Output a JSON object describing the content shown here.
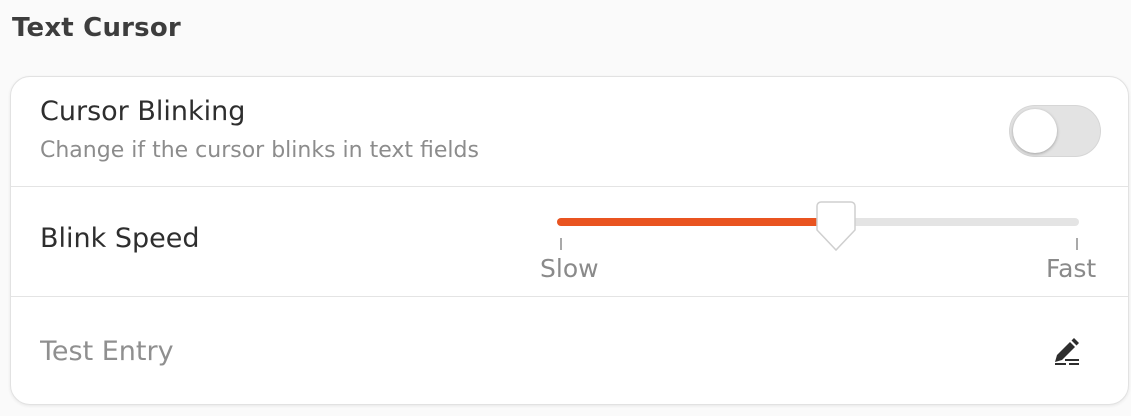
{
  "section": {
    "title": "Text Cursor"
  },
  "cursor_blinking": {
    "title": "Cursor Blinking",
    "subtitle": "Change if the cursor blinks in text fields",
    "enabled": false
  },
  "blink_speed": {
    "label": "Blink Speed",
    "min_label": "Slow",
    "max_label": "Fast",
    "value_fraction": 0.535
  },
  "test_entry": {
    "placeholder": "Test Entry",
    "value": ""
  },
  "icons": {
    "edit": "edit-pencil-icon"
  },
  "colors": {
    "accent": "#e95420",
    "track": "#e4e4e4",
    "toggle_off": "#e3e3e3"
  }
}
